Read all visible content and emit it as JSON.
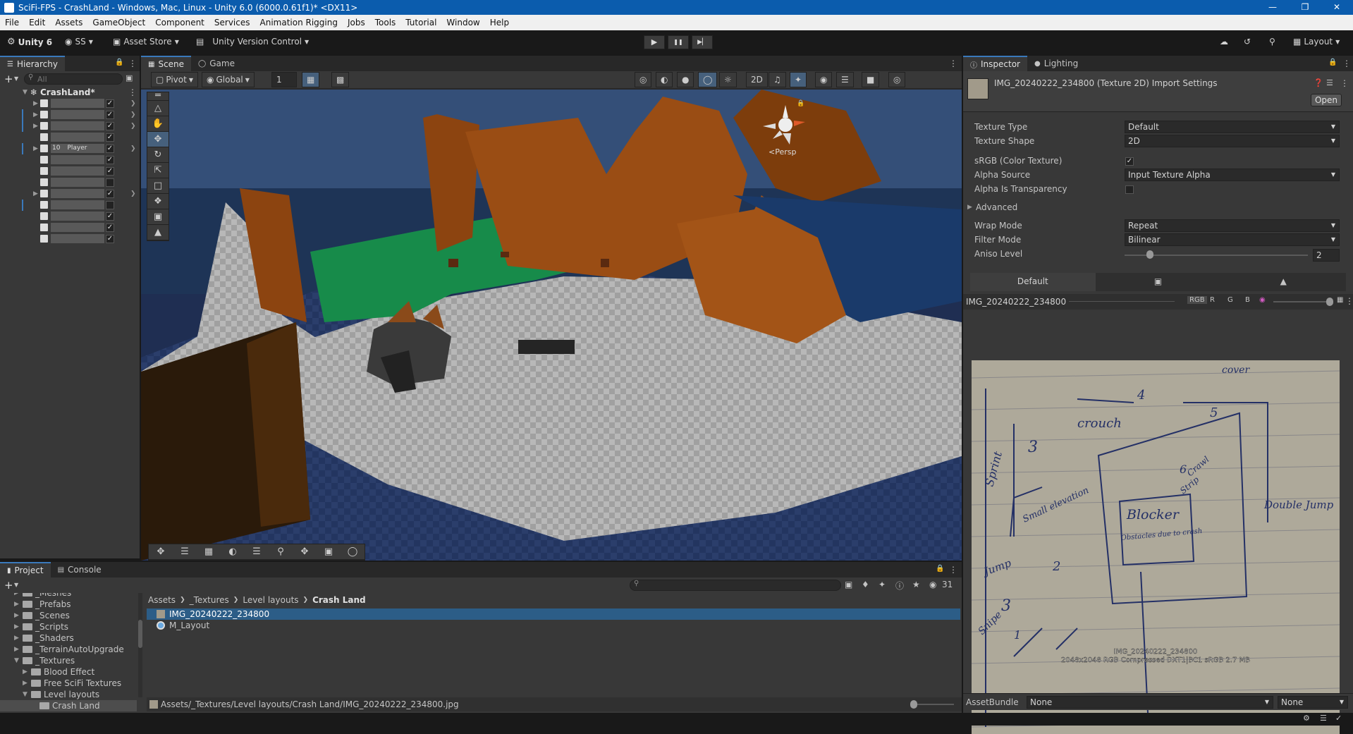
{
  "window": {
    "title": "SciFi-FPS - CrashLand - Windows, Mac, Linux - Unity 6.0 (6000.0.61f1)* <DX11>",
    "minimize": "—",
    "restore": "❐",
    "close": "✕"
  },
  "menu": [
    "File",
    "Edit",
    "Assets",
    "GameObject",
    "Component",
    "Services",
    "Animation Rigging",
    "Jobs",
    "Tools",
    "Tutorial",
    "Window",
    "Help"
  ],
  "toolbar": {
    "unity": "Unity 6",
    "account": "SS",
    "asset_store": "Asset Store",
    "version_control": "Unity Version Control",
    "layout": "Layout",
    "play": "▶",
    "pause": "❚❚",
    "step": "▶▏"
  },
  "hierarchy": {
    "tab": "Hierarchy",
    "search_placeholder": "All",
    "scene": "CrashLand*",
    "rows": [
      {
        "layer": "",
        "name": ""
      },
      {
        "layer": "",
        "name": ""
      },
      {
        "layer": "",
        "name": ""
      },
      {
        "layer": "",
        "name": ""
      },
      {
        "layer": "10",
        "name": "Player"
      },
      {
        "layer": "",
        "name": ""
      },
      {
        "layer": "",
        "name": ""
      },
      {
        "layer": "",
        "name": ""
      },
      {
        "layer": "",
        "name": ""
      },
      {
        "layer": "",
        "name": ""
      },
      {
        "layer": "",
        "name": ""
      },
      {
        "layer": "",
        "name": ""
      },
      {
        "layer": "",
        "name": ""
      }
    ]
  },
  "scene_view": {
    "tabs": [
      "Scene",
      "Game"
    ],
    "pivot": "Pivot",
    "global": "Global",
    "grid_value": "1",
    "persp": "<Persp"
  },
  "inspector": {
    "tabs": [
      "Inspector",
      "Lighting"
    ],
    "title": "IMG_20240222_234800 (Texture 2D) Import Settings",
    "open_button": "Open",
    "props": [
      {
        "label": "Texture Type",
        "value": "Default"
      },
      {
        "label": "Texture Shape",
        "value": "2D"
      }
    ],
    "srgb_label": "sRGB (Color Texture)",
    "alpha_source_label": "Alpha Source",
    "alpha_source_value": "Input Texture Alpha",
    "alpha_transparency_label": "Alpha Is Transparency",
    "advanced": "Advanced",
    "wrap_label": "Wrap Mode",
    "wrap_value": "Repeat",
    "filter_label": "Filter Mode",
    "filter_value": "Bilinear",
    "aniso_label": "Aniso Level",
    "aniso_value": "2",
    "platform_tab": "Default",
    "preview_name": "IMG_20240222_234800",
    "channels": [
      "RGB",
      "R",
      "G",
      "B"
    ],
    "preview_caption1": "IMG_20240222_234800",
    "preview_caption2": "2048x2048  RGB Compressed DXT1|BC1 sRGB  2.7 MB",
    "assetbundle_label": "AssetBundle",
    "assetbundle_value": "None",
    "assetbundle_variant": "None"
  },
  "sketch": {
    "words": [
      "cover",
      "crouch",
      "Sprint",
      "Small elevation",
      "Blocker",
      "Obstacles due to crash",
      "Jump",
      "Crawl",
      "Strip",
      "Double Jump",
      "Snipe"
    ],
    "numbers": [
      "4",
      "5",
      "3",
      "6",
      "2",
      "3",
      "1"
    ]
  },
  "project": {
    "tabs": [
      "Project",
      "Console"
    ],
    "breadcrumb": [
      "Assets",
      "_Textures",
      "Level layouts",
      "Crash Land"
    ],
    "tree": [
      {
        "name": "_Meshes",
        "indent": 1
      },
      {
        "name": "_Prefabs",
        "indent": 1
      },
      {
        "name": "_Scenes",
        "indent": 1
      },
      {
        "name": "_Scripts",
        "indent": 1
      },
      {
        "name": "_Shaders",
        "indent": 1
      },
      {
        "name": "_TerrainAutoUpgrade",
        "indent": 1
      },
      {
        "name": "_Textures",
        "indent": 1
      },
      {
        "name": "Blood Effect",
        "indent": 2
      },
      {
        "name": "Free SciFi Textures",
        "indent": 2
      },
      {
        "name": "Level layouts",
        "indent": 2
      },
      {
        "name": "Crash Land",
        "indent": 3
      }
    ],
    "files": [
      "IMG_20240222_234800",
      "M_Layout"
    ],
    "hidden_count": "31",
    "path": "Assets/_Textures/Level layouts/Crash Land/IMG_20240222_234800.jpg"
  }
}
